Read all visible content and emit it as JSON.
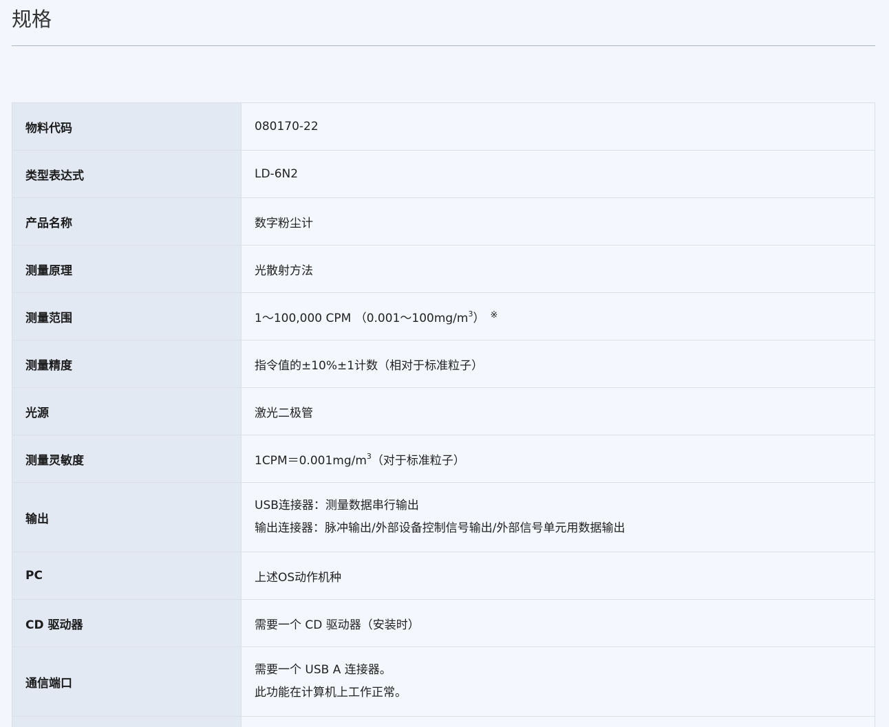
{
  "page": {
    "title": "规格"
  },
  "specs": [
    {
      "label": "物料代码",
      "value": "080170-22"
    },
    {
      "label": "类型表达式",
      "value": "LD-6N2"
    },
    {
      "label": "产品名称",
      "value": "数字粉尘计"
    },
    {
      "label": "测量原理",
      "value": "光散射方法"
    },
    {
      "label": "测量范围",
      "value_main": "1〜100,000 CPM （0.001〜100mg/m",
      "value_sup": "3",
      "value_end": "）",
      "value_note": "※"
    },
    {
      "label": "测量精度",
      "value": "指令值的±10%±1计数（相对于标准粒子）"
    },
    {
      "label": "光源",
      "value": "激光二极管"
    },
    {
      "label": "测量灵敏度",
      "value_main": "1CPM＝0.001mg/m",
      "value_sup": "3",
      "value_end": "（对于标准粒子）"
    },
    {
      "label": "输出",
      "lines": [
        "USB连接器：测量数据串行输出",
        "输出连接器：脉冲输出/外部设备控制信号输出/外部信号单元用数据输出"
      ]
    },
    {
      "label": "PC",
      "value": "上述OS动作机种"
    },
    {
      "label": "CD 驱动器",
      "value": "需要一个 CD 驱动器（安装时）"
    },
    {
      "label": "通信端口",
      "lines": [
        "需要一个 USB A 连接器。",
        "此功能在计算机上工作正常。"
      ]
    }
  ]
}
